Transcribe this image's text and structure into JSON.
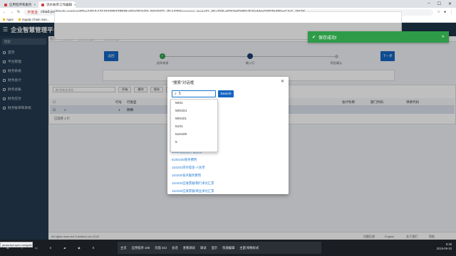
{
  "browser": {
    "tabs": [
      {
        "label": "应用程序和服务",
        "active": false
      },
      {
        "label": "流水帐单工作编辑",
        "active": true
      }
    ],
    "insecure_label": "不安全",
    "url": "cloud.yunhitech.com/wgi/f?p=100:3:171331995378838::NO:RP,3:P3_INVOICE_ID:1429&success_msg=SL-dSaZY5vdQSYqf7Y8%2Fi6jgMdcD2f2ZhiR5lmG4cF_I3S2Y",
    "bookmarks": [
      "Apps",
      "Supply Chain man...",
      "甲骨文文档 · Ora...",
      "JSON Introduction",
      "服务器 · 甲骨文...",
      "Oracle Fusion Sup...",
      "Home",
      "Douglas Volz Con...",
      "Oracle ERP 的...",
      "My Oracle Support",
      "PROD Sign In",
      "McGrosky Quarter...",
      "百度一下",
      "..."
    ]
  },
  "app": {
    "title": "企业智慧管理平台",
    "menu_icon": "hamburger-icon"
  },
  "sidebar": {
    "search_placeholder": "搜索",
    "items": [
      "首页",
      "平台管理",
      "财务系统",
      "财务会计",
      "财务总账",
      "财务应付",
      "财务账单和系统"
    ]
  },
  "breadcrumbs": [
    "首页",
    "财务管理",
    "运营发票工作单",
    "运营发票工作单"
  ],
  "steps": {
    "prev_label": "返回",
    "next_label": "下一步",
    "items": [
      {
        "label": "选择来源",
        "state": "done"
      },
      {
        "label": "输入行",
        "state": "current"
      },
      {
        "label": "预览确认",
        "state": "pending"
      }
    ]
  },
  "grid": {
    "search_placeholder": "按 所有文本列",
    "go_label": "开始",
    "actions_label": "操作",
    "save_label": "保存",
    "add_row_label": "添加行",
    "columns": [
      "行号",
      "行类型",
      "金额",
      "数量",
      "说明",
      "会计科目",
      "部门代码",
      "项目代码"
    ],
    "row": {
      "line": "1",
      "type": "明细"
    },
    "row_count": "已选择 1 行"
  },
  "toast": {
    "message": "保存成功!",
    "color": "#2e9b49"
  },
  "modal": {
    "title": "\"搜索\"对话框",
    "search_value": "5",
    "search_button": "Search",
    "results": [
      "5001/销售费用-运营费",
      "5100105/商务费用",
      "110101/库存现金-人民币",
      "110102/技术服务费用",
      "112101/应收票据/银行承兑汇票",
      "112102/应收票据/商业承兑汇票"
    ]
  },
  "dropdown": {
    "options": [
      "5001",
      "500104",
      "500101",
      "5101",
      "510109",
      "5"
    ]
  },
  "footer": {
    "copyright": "All rights reserved Yunhitech.inc 2018",
    "links": [
      "问题反馈",
      "English",
      "关于我们",
      "帮助"
    ]
  },
  "taskbar": {
    "items": [
      "主页",
      "应用程序 100",
      "页面 312",
      "会话",
      "查看调试",
      "调试",
      "显示",
      "快速编辑",
      "主题 网格样式"
    ],
    "time": "8:29",
    "date": "2019-09-10"
  },
  "status_url": "javascript:apex.navigation.dialog..."
}
